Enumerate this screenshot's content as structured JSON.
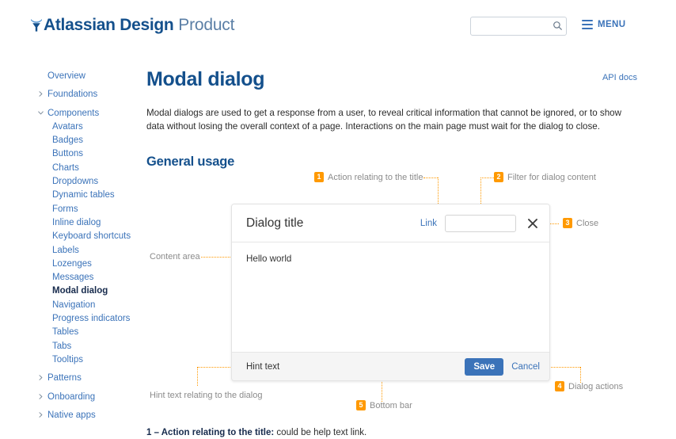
{
  "header": {
    "logo_bold": "Atlassian Design",
    "logo_light": "Product",
    "logo_mark_name": "atlassian-logo-icon",
    "search_value": "",
    "search_placeholder": "",
    "menu_label": "MENU"
  },
  "sidebar": {
    "items": [
      {
        "label": "Overview",
        "level": 0,
        "caret": "",
        "active": false
      },
      {
        "label": "Foundations",
        "level": 0,
        "caret": "right",
        "active": false
      },
      {
        "label": "Components",
        "level": 0,
        "caret": "down",
        "active": false
      },
      {
        "label": "Avatars",
        "level": 1,
        "caret": "",
        "active": false
      },
      {
        "label": "Badges",
        "level": 1,
        "caret": "",
        "active": false
      },
      {
        "label": "Buttons",
        "level": 1,
        "caret": "",
        "active": false
      },
      {
        "label": "Charts",
        "level": 1,
        "caret": "",
        "active": false
      },
      {
        "label": "Dropdowns",
        "level": 1,
        "caret": "",
        "active": false
      },
      {
        "label": "Dynamic tables",
        "level": 1,
        "caret": "",
        "active": false
      },
      {
        "label": "Forms",
        "level": 1,
        "caret": "",
        "active": false
      },
      {
        "label": "Inline dialog",
        "level": 1,
        "caret": "",
        "active": false
      },
      {
        "label": "Keyboard shortcuts",
        "level": 1,
        "caret": "",
        "active": false
      },
      {
        "label": "Labels",
        "level": 1,
        "caret": "",
        "active": false
      },
      {
        "label": "Lozenges",
        "level": 1,
        "caret": "",
        "active": false
      },
      {
        "label": "Messages",
        "level": 1,
        "caret": "",
        "active": false
      },
      {
        "label": "Modal dialog",
        "level": 1,
        "caret": "",
        "active": true
      },
      {
        "label": "Navigation",
        "level": 1,
        "caret": "",
        "active": false
      },
      {
        "label": "Progress indicators",
        "level": 1,
        "caret": "",
        "active": false
      },
      {
        "label": "Tables",
        "level": 1,
        "caret": "",
        "active": false
      },
      {
        "label": "Tabs",
        "level": 1,
        "caret": "",
        "active": false
      },
      {
        "label": "Tooltips",
        "level": 1,
        "caret": "",
        "active": false
      },
      {
        "label": "Patterns",
        "level": 0,
        "caret": "right",
        "active": false
      },
      {
        "label": "Onboarding",
        "level": 0,
        "caret": "right",
        "active": false
      },
      {
        "label": "Native apps",
        "level": 0,
        "caret": "right",
        "active": false
      }
    ]
  },
  "main": {
    "title": "Modal dialog",
    "api_docs_label": "API docs",
    "lede": "Modal dialogs are used to get a response from a user, to reveal critical information that cannot be ignored, or to show data without losing the overall context of a page. Interactions on the main page must wait for the dialog to close.",
    "section_title": "General usage"
  },
  "annotations": [
    {
      "num": "1",
      "label": "Action relating to the title"
    },
    {
      "num": "2",
      "label": "Filter for dialog content"
    },
    {
      "num": "3",
      "label": "Close"
    },
    {
      "num": "4",
      "label": "Dialog actions"
    },
    {
      "num": "5",
      "label": "Bottom bar"
    }
  ],
  "plain_annotations": [
    {
      "label": "Content area"
    },
    {
      "label": "Hint text relating to the dialog"
    }
  ],
  "dialog": {
    "title": "Dialog title",
    "link_label": "Link",
    "filter_value": "",
    "filter_placeholder": "",
    "close_icon": "close-icon",
    "body_text": "Hello world",
    "hint_text": "Hint text",
    "save_label": "Save",
    "cancel_label": "Cancel"
  },
  "footnote": {
    "bold": "1 – Action relating to the title:",
    "rest": " could be help text link."
  },
  "colors": {
    "accent_blue": "#3b73b9",
    "heading_blue": "#14508c",
    "annotation_orange": "#f90",
    "footer_gray": "#f5f5f5"
  }
}
